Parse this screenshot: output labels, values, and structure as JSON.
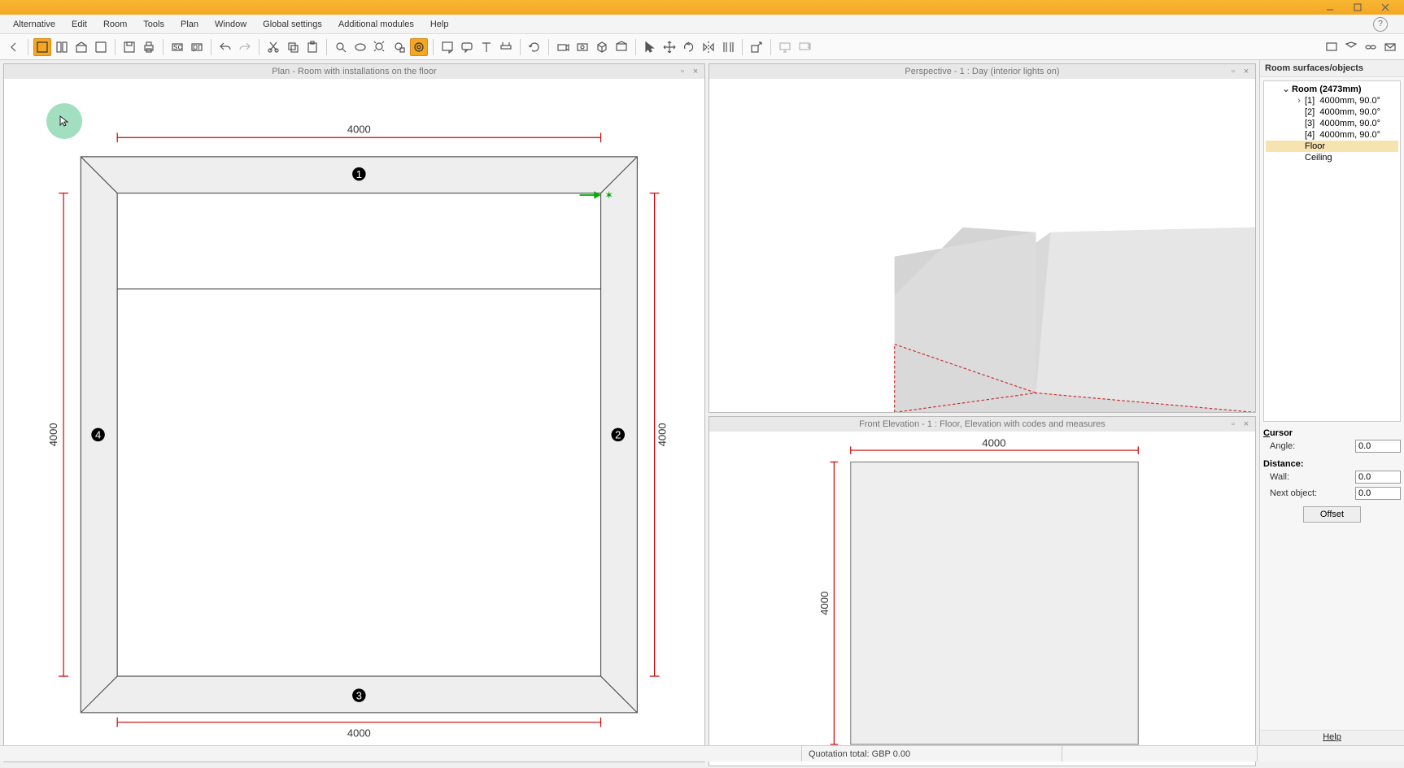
{
  "menus": {
    "alternative": "Alternative",
    "edit": "Edit",
    "room": "Room",
    "tools": "Tools",
    "plan": "Plan",
    "window": "Window",
    "global": "Global settings",
    "modules": "Additional modules",
    "help": "Help"
  },
  "brand": "",
  "panels": {
    "plan_title": "Plan - Room with installations on the floor",
    "perspective_title": "Perspective - 1 : Day (interior lights on)",
    "elevation_title": "Front Elevation - 1 : Floor, Elevation with codes and measures"
  },
  "plan": {
    "dim_top": "4000",
    "dim_bottom": "4000",
    "dim_left": "4000",
    "dim_right": "4000",
    "wall_labels": {
      "top": "1",
      "right": "2",
      "bottom": "3",
      "left": "4"
    }
  },
  "elevation": {
    "dim_top": "4000",
    "dim_left": "4000"
  },
  "side": {
    "title": "Room surfaces/objects",
    "room_label": "Room (2473mm)",
    "walls": [
      {
        "idx": "[1]",
        "desc": "4000mm, 90.0°"
      },
      {
        "idx": "[2]",
        "desc": "4000mm, 90.0°"
      },
      {
        "idx": "[3]",
        "desc": "4000mm, 90.0°"
      },
      {
        "idx": "[4]",
        "desc": "4000mm, 90.0°"
      }
    ],
    "floor": "Floor",
    "ceiling": "Ceiling"
  },
  "cursor": {
    "section": "Cursor",
    "angle_label": "Angle:",
    "angle": "0.0",
    "distance_section": "Distance:",
    "wall_label": "Wall:",
    "wall": "0.0",
    "next_label": "Next object:",
    "next": "0.0",
    "offset_btn": "Offset"
  },
  "help_link": "Help",
  "status": {
    "quotation": "Quotation total: GBP 0.00"
  }
}
